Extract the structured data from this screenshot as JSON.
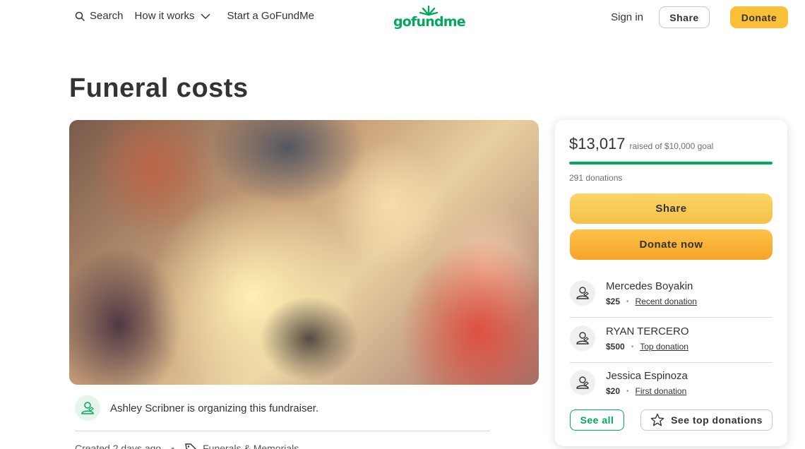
{
  "header": {
    "search_label": "Search",
    "how_it_works_label": "How it works",
    "start_label": "Start a GoFundMe",
    "logo_text": "gofundme",
    "sign_in_label": "Sign in",
    "share_label": "Share",
    "donate_label": "Donate"
  },
  "campaign": {
    "title": "Funeral costs",
    "organizer_text": "Ashley Scribner is organizing this fundraiser.",
    "created_text": "Created 2 days ago",
    "category": "Funerals & Memorials"
  },
  "card": {
    "raised_amount": "$13,017",
    "raised_goal_text": "raised of $10,000 goal",
    "progress_fraction": 1.0,
    "donations_count": "291 donations",
    "share_label": "Share",
    "donate_now_label": "Donate now",
    "donors": [
      {
        "name": "Mercedes Boyakin",
        "amount": "$25",
        "tag": "Recent donation"
      },
      {
        "name": "RYAN TERCERO",
        "amount": "$500",
        "tag": "Top donation"
      },
      {
        "name": "Jessica Espinoza",
        "amount": "$20",
        "tag": "First donation"
      }
    ],
    "see_all_label": "See all",
    "see_top_label": "See top donations"
  },
  "icons": {
    "search": "search-icon",
    "chevron": "chevron-down-icon",
    "user": "user-icon",
    "tag": "tag-icon",
    "star": "star-icon"
  },
  "colors": {
    "brand_green": "#02a95c",
    "donate_yellow": "#f9c037",
    "donate_orange": "#f5a426"
  }
}
